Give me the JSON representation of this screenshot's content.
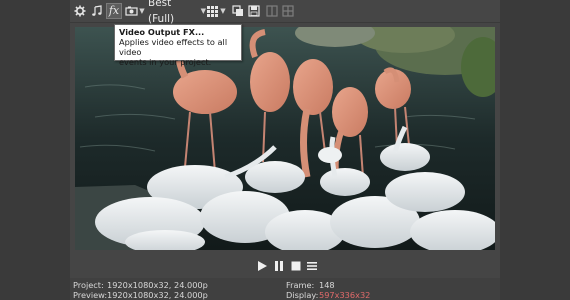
{
  "toolbar": {
    "fx_label": "fx",
    "quality_label": "Best (Full)",
    "icons": [
      "gear-icon",
      "music-note-icon",
      "fx-icon",
      "camera-icon",
      "grid-icon",
      "copy-icon",
      "save-icon",
      "split-screen-icon",
      "overlay-icon"
    ]
  },
  "tooltip": {
    "title": "Video Output FX...",
    "line1": "Applies video effects to all video",
    "line2": "events in your project."
  },
  "transport": {
    "buttons": [
      "play-icon",
      "pause-icon",
      "stop-icon",
      "menu-icon"
    ]
  },
  "status": {
    "project_label": "Project:",
    "project_value": "1920x1080x32, 24.000p",
    "preview_label": "Preview:",
    "preview_value": "1920x1080x32, 24.000p",
    "frame_label": "Frame:",
    "frame_value": "148",
    "display_label": "Display:",
    "display_value": "597x336x32"
  },
  "colors": {
    "panel_bg": "#454545",
    "highlight_value": "#e06a6a",
    "tooltip_bg": "#ffffff"
  }
}
